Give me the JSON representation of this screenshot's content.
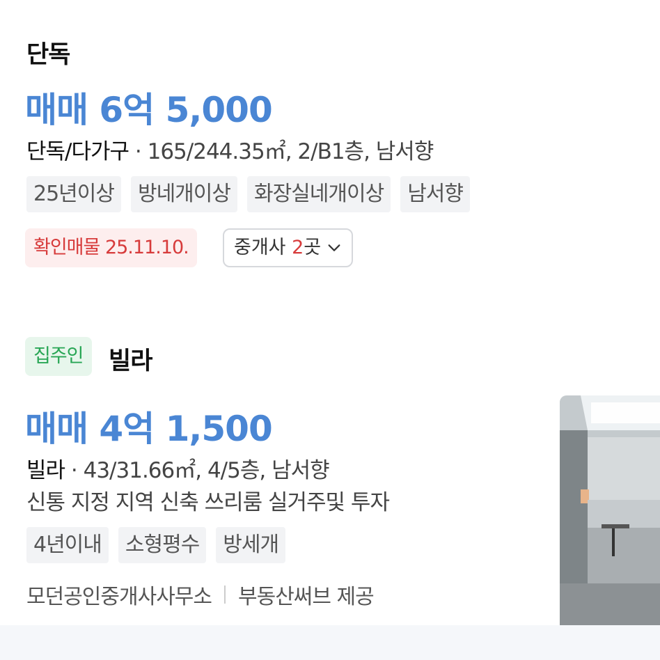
{
  "listings": [
    {
      "type": "단독",
      "price": "매매 6억 5,000",
      "kind": "단독/다가구",
      "spec": " · 165/244.35㎡, 2/B1층, 남서향",
      "tags": [
        "25년이상",
        "방네개이상",
        "화장실네개이상",
        "남서향"
      ],
      "confirm": "확인매물 25.11.10.",
      "agents_label": "중개사 ",
      "agents_count": "2",
      "agents_unit": "곳"
    },
    {
      "owner_badge": "집주인",
      "type": "빌라",
      "price": "매매 4억 1,500",
      "kind": "빌라",
      "spec": " · 43/31.66㎡, 4/5층, 남서향",
      "description": "신통 지정 지역 신축 쓰리룸 실거주및 투자",
      "tags": [
        "4년이내",
        "소형평수",
        "방세개"
      ],
      "agency": "모던공인중개사사무소",
      "provider": "부동산써브 제공"
    }
  ],
  "icons": {
    "chevron": "chevron-down-icon"
  },
  "colors": {
    "price": "#4a86d4",
    "confirm": "#d73b3b",
    "owner": "#28a655"
  }
}
